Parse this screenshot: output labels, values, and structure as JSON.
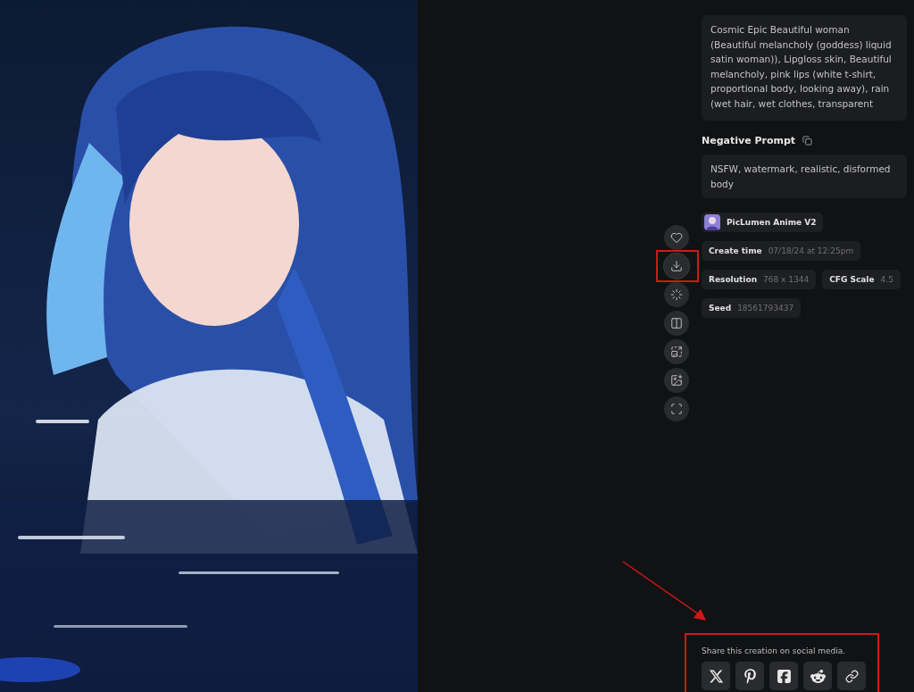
{
  "image": {
    "kind": "picture"
  },
  "actions": [
    {
      "kind": "like",
      "highlighted": false
    },
    {
      "kind": "download",
      "highlighted": true
    },
    {
      "kind": "variation",
      "highlighted": false
    },
    {
      "kind": "compare",
      "highlighted": false
    },
    {
      "kind": "upscale",
      "highlighted": false
    },
    {
      "kind": "edit",
      "highlighted": false
    },
    {
      "kind": "focus",
      "highlighted": false
    }
  ],
  "prompt": {
    "text": "Cosmic Epic Beautiful woman (Beautiful melancholy (goddess) liquid satin woman)), Lipgloss skin, Beautiful melancholy, pink lips (white t-shirt, proportional body, looking away), rain (wet hair, wet clothes, transparent"
  },
  "negative_prompt": {
    "label": "Negative Prompt",
    "text": "NSFW, watermark, realistic, disformed body"
  },
  "model": {
    "name": "PicLumen Anime V2"
  },
  "details": [
    [
      {
        "label": "Create time",
        "value": "07/18/24 at 12:25pm"
      }
    ],
    [
      {
        "label": "Resolution",
        "value": "768 x 1344"
      },
      {
        "label": "CFG Scale",
        "value": "4.5"
      }
    ],
    [
      {
        "label": "Seed",
        "value": "18561793437"
      }
    ]
  ],
  "share": {
    "title": "Share this creation on social media.",
    "highlighted": true,
    "pointer_arrow": true,
    "buttons": [
      {
        "kind": "x"
      },
      {
        "kind": "pinterest"
      },
      {
        "kind": "facebook"
      },
      {
        "kind": "reddit"
      },
      {
        "kind": "link"
      }
    ]
  }
}
